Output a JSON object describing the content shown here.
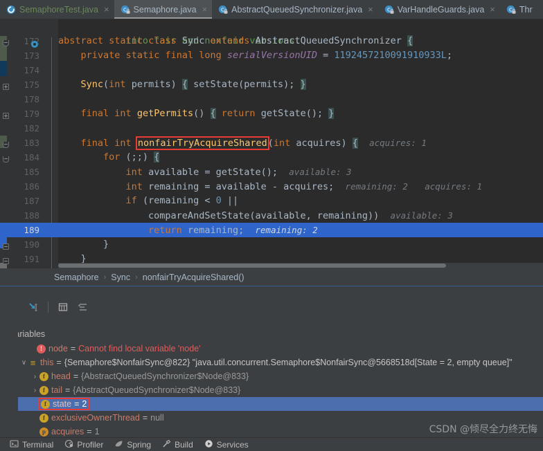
{
  "tabs": [
    {
      "label": "SemaphoreTest.java",
      "icon": "java-test-class-icon",
      "active": false,
      "green": true
    },
    {
      "label": "Semaphore.java",
      "icon": "java-class-locked-icon",
      "active": true,
      "green": false
    },
    {
      "label": "AbstractQueuedSynchronizer.java",
      "icon": "java-class-locked-icon",
      "active": false,
      "green": false
    },
    {
      "label": "VarHandleGuards.java",
      "icon": "java-class-locked-icon",
      "active": false,
      "green": false
    },
    {
      "label": "Thr",
      "icon": "java-class-locked-icon",
      "active": false,
      "green": false
    }
  ],
  "tab_close_glyph": "×",
  "editor": {
    "highlighted_method": "nonfairTryAcquireShared",
    "current_line": 189,
    "lines": [
      {
        "num": "",
        "fold": "",
        "text": "  into fair and nonfair versions."
      },
      {
        "num": "172",
        "fold": "minus",
        "text": "abstract static class Sync extends AbstractQueuedSynchronizer {"
      },
      {
        "num": "173",
        "fold": "",
        "text": "    private static final long serialVersionUID = 1192457210091910933L;"
      },
      {
        "num": "174",
        "fold": "",
        "text": ""
      },
      {
        "num": "175",
        "fold": "plus",
        "text": "    Sync(int permits) { setState(permits); }"
      },
      {
        "num": "178",
        "fold": "",
        "text": ""
      },
      {
        "num": "179",
        "fold": "plus",
        "text": "    final int getPermits() { return getState(); }"
      },
      {
        "num": "182",
        "fold": "",
        "text": ""
      },
      {
        "num": "183",
        "fold": "minus",
        "text": "    final int nonfairTryAcquireShared(int acquires) {   acquires: 1"
      },
      {
        "num": "184",
        "fold": "minus",
        "text": "        for (;;) {"
      },
      {
        "num": "185",
        "fold": "",
        "text": "            int available = getState();   available: 3"
      },
      {
        "num": "186",
        "fold": "",
        "text": "            int remaining = available - acquires;   remaining: 2    acquires: 1"
      },
      {
        "num": "187",
        "fold": "",
        "text": "            if (remaining < 0 ||"
      },
      {
        "num": "188",
        "fold": "",
        "text": "                compareAndSetState(available, remaining))   available: 3"
      },
      {
        "num": "189",
        "fold": "",
        "text": "                return remaining;   remaining: 2"
      },
      {
        "num": "190",
        "fold": "minus",
        "text": "        }"
      },
      {
        "num": "191",
        "fold": "minus",
        "text": "    }"
      }
    ],
    "inline_hints": {
      "acquires_183": "acquires: 1",
      "available_185": "available: 3",
      "remaining_186": "remaining: 2",
      "acquires_186": "acquires: 1",
      "available_188": "available: 3",
      "remaining_189": "remaining: 2"
    }
  },
  "breadcrumb": {
    "separator": "›",
    "items": [
      "Semaphore",
      "Sync",
      "nonfairTryAcquireShared()"
    ]
  },
  "debug_toolbar": {
    "buttons": [
      {
        "name": "mute-breakpoints-icon",
        "label": ""
      },
      {
        "name": "evaluate-expression-icon",
        "label": ""
      },
      {
        "name": "layout-table-icon",
        "label": ""
      },
      {
        "name": "sort-values-icon",
        "label": ""
      }
    ]
  },
  "variables": {
    "title": "Variables",
    "side_buttons": [
      "+",
      "−",
      "▲",
      "▼",
      "»"
    ],
    "rows": [
      {
        "indent": 1,
        "expander": "",
        "badge": "err",
        "badge_text": "!",
        "name": "node",
        "eq": "=",
        "value": "Cannot find local variable 'node'",
        "value_style": "err",
        "selected": false,
        "boxed": false
      },
      {
        "indent": 0,
        "expander": "∨",
        "badge": "obj",
        "badge_text": "≡",
        "name": "this",
        "eq": "=",
        "value": "{Semaphore$NonfairSync@822} \"java.util.concurrent.Semaphore$NonfairSync@5668518d[State = 2, empty queue]\"",
        "value_style": "mixed",
        "selected": false,
        "boxed": false
      },
      {
        "indent": 1,
        "expander": "›",
        "badge": "f",
        "badge_text": "f",
        "name": "head",
        "eq": "=",
        "value": "{AbstractQueuedSynchronizer$Node@833}",
        "value_style": "val",
        "selected": false,
        "boxed": false
      },
      {
        "indent": 1,
        "expander": "›",
        "badge": "f",
        "badge_text": "f",
        "name": "tail",
        "eq": "=",
        "value": "{AbstractQueuedSynchronizer$Node@833}",
        "value_style": "val",
        "selected": false,
        "boxed": false
      },
      {
        "indent": 1,
        "expander": "",
        "badge": "f",
        "badge_text": "f",
        "name": "state",
        "eq": "=",
        "value": "2",
        "value_style": "plain",
        "selected": true,
        "boxed": true
      },
      {
        "indent": 1,
        "expander": "",
        "badge": "f",
        "badge_text": "f",
        "name": "exclusiveOwnerThread",
        "eq": "=",
        "value": "null",
        "value_style": "plain",
        "selected": false,
        "boxed": false
      },
      {
        "indent": 1,
        "expander": "",
        "badge": "p",
        "badge_text": "p",
        "name": "acquires",
        "eq": "=",
        "value": "1",
        "value_style": "plain",
        "selected": false,
        "boxed": false
      }
    ]
  },
  "status_bar": {
    "items": [
      {
        "label": "Terminal",
        "icon": "terminal-icon"
      },
      {
        "label": "Profiler",
        "icon": "profiler-icon"
      },
      {
        "label": "Spring",
        "icon": "spring-leaf-icon"
      },
      {
        "label": "Build",
        "icon": "build-hammer-icon"
      },
      {
        "label": "Services",
        "icon": "services-play-icon"
      }
    ]
  },
  "watermark": "CSDN @倾尽全力终无悔",
  "colors": {
    "editor_bg": "#2b2b2b",
    "panel_bg": "#3c3f41",
    "gutter_bg": "#313335",
    "highlight_line": "#2f65ca",
    "selection": "#4b6eaf",
    "red_box": "#e83b34",
    "keyword": "#cc7832",
    "method": "#ffc66d",
    "number": "#6897bb",
    "field": "#9876aa",
    "comment": "#629755",
    "inline_hint": "#747a80",
    "text": "#a9b7c6"
  }
}
